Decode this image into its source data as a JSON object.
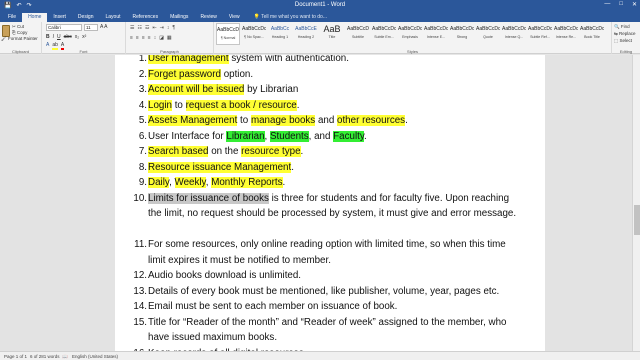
{
  "window": {
    "title": "Document1 - Word",
    "controls": [
      "—",
      "□",
      "✕"
    ]
  },
  "qat": [
    "💾",
    "↶",
    "↷"
  ],
  "tabs": [
    "File",
    "Home",
    "Insert",
    "Design",
    "Layout",
    "References",
    "Mailings",
    "Review",
    "View"
  ],
  "tellme": "Tell me what you want to do...",
  "ribbon": {
    "clipboard": {
      "paste": "Paste",
      "cut": "Cut",
      "copy": "Copy",
      "format_painter": "Format Painter",
      "label": "Clipboard"
    },
    "font": {
      "name": "Calibri",
      "size": "11",
      "label": "Font"
    },
    "paragraph": {
      "label": "Paragraph"
    },
    "styles": {
      "label": "Styles",
      "items": [
        {
          "sample": "AaBbCcDc",
          "name": "¶ Normal"
        },
        {
          "sample": "AaBbCcDc",
          "name": "¶ No Spac..."
        },
        {
          "sample": "AaBbCc",
          "name": "Heading 1"
        },
        {
          "sample": "AaBbCcE",
          "name": "Heading 2"
        },
        {
          "sample": "AaB",
          "name": "Title"
        },
        {
          "sample": "AaBbCcD",
          "name": "Subtitle"
        },
        {
          "sample": "AaBbCcDc",
          "name": "Subtle Em..."
        },
        {
          "sample": "AaBbCcDc",
          "name": "Emphasis"
        },
        {
          "sample": "AaBbCcDc",
          "name": "Intense E..."
        },
        {
          "sample": "AaBbCcDc",
          "name": "Strong"
        },
        {
          "sample": "AaBbCcDc",
          "name": "Quote"
        },
        {
          "sample": "AaBbCcDc",
          "name": "Intense Q..."
        },
        {
          "sample": "AaBbCcDc",
          "name": "Subtle Ref..."
        },
        {
          "sample": "AaBbCcDc",
          "name": "Intense Re..."
        },
        {
          "sample": "AaBbCcDc",
          "name": "Book Title"
        }
      ]
    },
    "editing": {
      "find": "Find",
      "replace": "Replace",
      "select": "Select",
      "label": "Editing"
    }
  },
  "document": {
    "items": [
      {
        "num": "1.",
        "segments": [
          {
            "t": "User management",
            "h": "y"
          },
          {
            "t": " system with authentication."
          }
        ]
      },
      {
        "num": "2.",
        "segments": [
          {
            "t": "Forget password",
            "h": "y"
          },
          {
            "t": " option."
          }
        ]
      },
      {
        "num": "3.",
        "segments": [
          {
            "t": "Account will be issued",
            "h": "y"
          },
          {
            "t": " by Librarian"
          }
        ]
      },
      {
        "num": "4.",
        "segments": [
          {
            "t": "Login",
            "h": "y"
          },
          {
            "t": " to "
          },
          {
            "t": "request a book / resource",
            "h": "y"
          },
          {
            "t": "."
          }
        ]
      },
      {
        "num": "5.",
        "segments": [
          {
            "t": "Assets Management",
            "h": "y"
          },
          {
            "t": " to "
          },
          {
            "t": "manage books",
            "h": "y"
          },
          {
            "t": " and "
          },
          {
            "t": "other resources",
            "h": "y"
          },
          {
            "t": "."
          }
        ]
      },
      {
        "num": "6.",
        "segments": [
          {
            "t": "User Interface for "
          },
          {
            "t": "Librarian",
            "h": "g"
          },
          {
            "t": ", "
          },
          {
            "t": "Students",
            "h": "g"
          },
          {
            "t": ", and "
          },
          {
            "t": "Faculty",
            "h": "g"
          },
          {
            "t": "."
          }
        ]
      },
      {
        "num": "7.",
        "segments": [
          {
            "t": "Search based",
            "h": "y"
          },
          {
            "t": " on the "
          },
          {
            "t": "resource type",
            "h": "y"
          },
          {
            "t": "."
          }
        ]
      },
      {
        "num": "8.",
        "segments": [
          {
            "t": "Resource issuance Management",
            "h": "y"
          },
          {
            "t": "."
          }
        ]
      },
      {
        "num": "9.",
        "segments": [
          {
            "t": "Daily",
            "h": "y"
          },
          {
            "t": ", "
          },
          {
            "t": "Weekly",
            "h": "y"
          },
          {
            "t": ", "
          },
          {
            "t": "Monthly Reports",
            "h": "y"
          },
          {
            "t": "."
          }
        ]
      },
      {
        "num": "10.",
        "segments": [
          {
            "t": "Limits for issuance of books",
            "h": "s"
          },
          {
            "t": " is three for students and for faculty five. Upon reaching the limit, no request should be processed by system, it must give and error message."
          }
        ]
      },
      {
        "num": "11.",
        "segments": [
          {
            "t": "For some resources, only online reading option with limited time, so when this time limit expires it must be notified to member."
          }
        ]
      },
      {
        "num": "12.",
        "segments": [
          {
            "t": "Audio books download is unlimited."
          }
        ]
      },
      {
        "num": "13.",
        "segments": [
          {
            "t": "Details of every book must be mentioned, like publisher, volume, year, pages etc."
          }
        ]
      },
      {
        "num": "14.",
        "segments": [
          {
            "t": "Email must be sent to each member on issuance of book."
          }
        ]
      },
      {
        "num": "15.",
        "segments": [
          {
            "t": "Title for “Reader of the month” and “Reader of week” assigned to the member, who have issued maximum books."
          }
        ]
      },
      {
        "num": "16.",
        "segments": [
          {
            "t": "Keep records of all digital resources."
          }
        ]
      }
    ]
  },
  "status": {
    "page": "Page 1 of 1",
    "words": "6 of 281 words",
    "language": "English (United States)"
  },
  "colors": {
    "titlebar": "#2b579a",
    "highlight_yellow": "#ffff33",
    "highlight_green": "#33ee33",
    "selection": "#c8c8c8"
  }
}
